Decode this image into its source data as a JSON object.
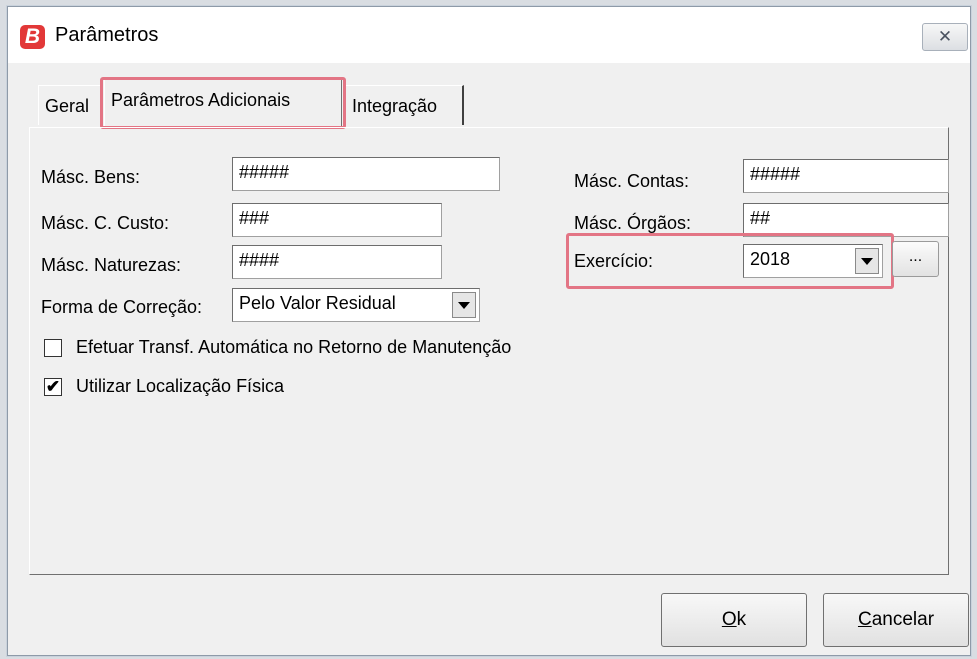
{
  "window": {
    "app_logo": "B",
    "title": "Parâmetros",
    "close_symbol": "✕"
  },
  "tabs": [
    {
      "label": "Geral"
    },
    {
      "label": "Parâmetros Adicionais",
      "selected": true
    },
    {
      "label": "Integração"
    }
  ],
  "form": {
    "masc_bens": {
      "label": "Másc. Bens:",
      "value": "#####"
    },
    "masc_ccusto": {
      "label": "Másc. C. Custo:",
      "value": "###"
    },
    "masc_naturezas": {
      "label": "Másc. Naturezas:",
      "value": "####"
    },
    "forma_correcao": {
      "label": "Forma de Correção:",
      "value": "Pelo Valor Residual"
    },
    "masc_contas": {
      "label": "Másc. Contas:",
      "value": "#####"
    },
    "masc_orgaos": {
      "label": "Másc. Órgãos:",
      "value": "##"
    },
    "exercicio": {
      "label": "Exercício:",
      "value": "2018",
      "browse_label": "..."
    },
    "checkboxes": [
      {
        "label": "Efetuar Transf. Automática no Retorno de Manutenção",
        "checked": false
      },
      {
        "label": "Utilizar Localização Física",
        "checked": true
      }
    ]
  },
  "buttons": {
    "ok_mnemonic": "O",
    "ok_rest": "k",
    "cancel_mnemonic": "C",
    "cancel_rest": "ancelar"
  },
  "icons": {
    "logo": "app-logo-icon",
    "close": "close-icon",
    "dropdown": "chevron-down-icon",
    "check": "checkmark-icon"
  },
  "colors": {
    "highlight": "#e37585",
    "logo_bg": "#e23838"
  }
}
